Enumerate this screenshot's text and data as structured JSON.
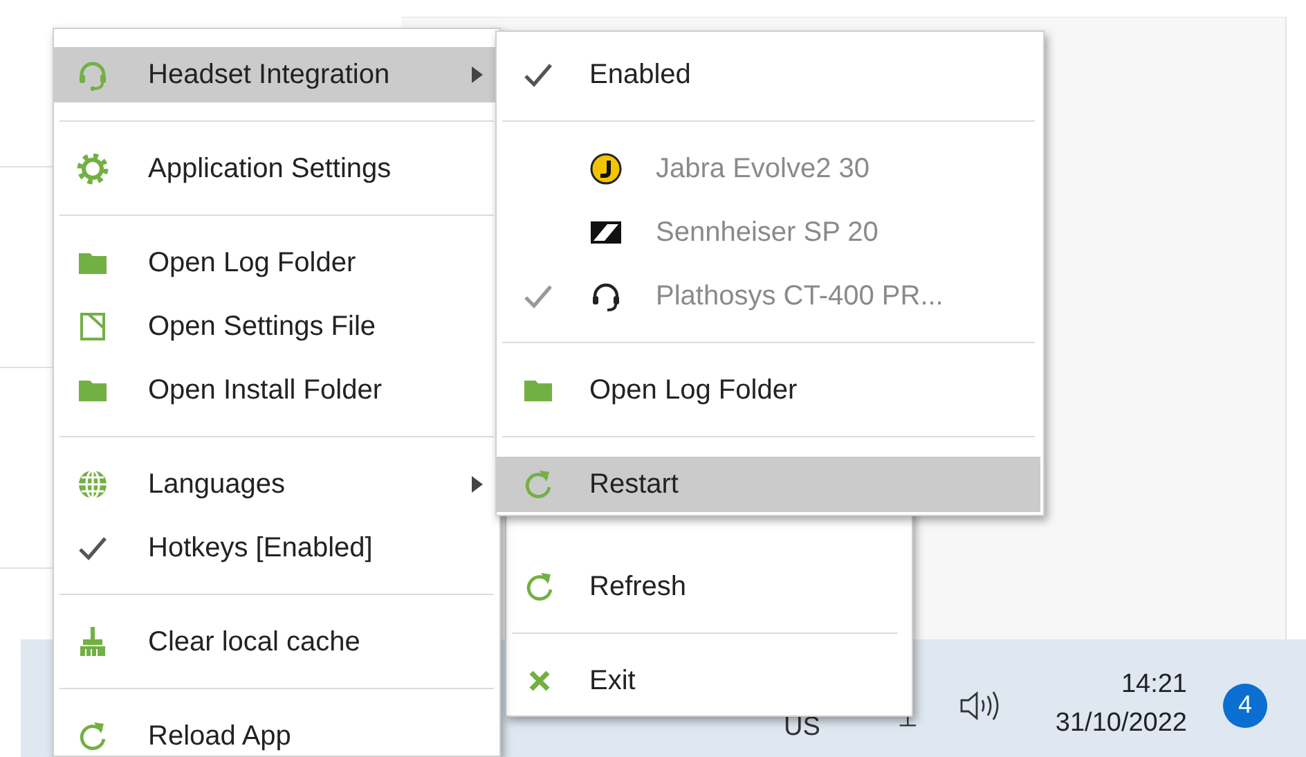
{
  "main_menu": {
    "items": [
      {
        "kind": "item",
        "label": "Headset Integration",
        "selected": true,
        "checked": false,
        "submenu": true
      },
      {
        "kind": "separator"
      },
      {
        "kind": "item",
        "label": "Application Settings",
        "selected": false,
        "checked": false,
        "submenu": false
      },
      {
        "kind": "separator"
      },
      {
        "kind": "item",
        "label": "Open Log Folder",
        "selected": false,
        "checked": false,
        "submenu": false
      },
      {
        "kind": "item",
        "label": "Open Settings File",
        "selected": false,
        "checked": false,
        "submenu": false
      },
      {
        "kind": "item",
        "label": "Open Install Folder",
        "selected": false,
        "checked": false,
        "submenu": false
      },
      {
        "kind": "separator"
      },
      {
        "kind": "item",
        "label": "Languages",
        "selected": false,
        "checked": false,
        "submenu": true
      },
      {
        "kind": "item",
        "label": "Hotkeys [Enabled]",
        "selected": false,
        "checked": true,
        "submenu": false
      },
      {
        "kind": "separator"
      },
      {
        "kind": "item",
        "label": "Clear local cache",
        "selected": false,
        "checked": false,
        "submenu": false
      },
      {
        "kind": "separator"
      },
      {
        "kind": "item",
        "label": "Reload App",
        "selected": false,
        "checked": false,
        "submenu": false
      }
    ]
  },
  "submenu": {
    "items": [
      {
        "kind": "item",
        "label": "Enabled",
        "selected": false,
        "checked": true,
        "disabled": false
      },
      {
        "kind": "separator"
      },
      {
        "kind": "device",
        "label": "Jabra Evolve2 30",
        "selected": false,
        "checked": false,
        "disabled": true
      },
      {
        "kind": "device",
        "label": "Sennheiser SP 20",
        "selected": false,
        "checked": false,
        "disabled": true
      },
      {
        "kind": "device",
        "label": "Plathosys CT-400 PR...",
        "selected": false,
        "checked": true,
        "disabled": true
      },
      {
        "kind": "separator"
      },
      {
        "kind": "item",
        "label": "Open Log Folder",
        "selected": false,
        "checked": false,
        "disabled": false
      },
      {
        "kind": "separator"
      },
      {
        "kind": "item",
        "label": "Restart",
        "selected": true,
        "checked": false,
        "disabled": false
      }
    ]
  },
  "tray_menu": {
    "items": [
      {
        "kind": "item",
        "label": "Refresh",
        "selected": false
      },
      {
        "kind": "separator"
      },
      {
        "kind": "item",
        "label": "Exit",
        "selected": false
      }
    ]
  },
  "taskbar": {
    "language": "US",
    "time": "14:21",
    "date": "31/10/2022",
    "notifications": "4"
  }
}
